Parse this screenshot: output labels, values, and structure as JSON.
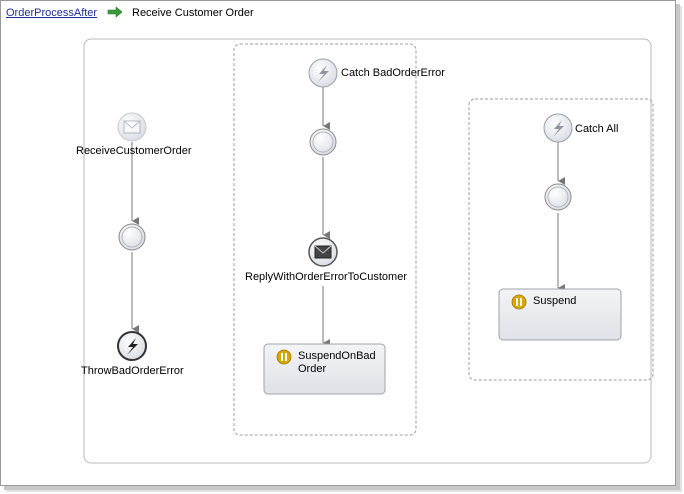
{
  "breadcrumb": {
    "parent_link": "OrderProcessAfter",
    "current": "Receive Customer Order"
  },
  "main_flow": {
    "receive_label": "ReceiveCustomerOrder",
    "throw_label": "ThrowBadOrderError"
  },
  "catch_bad_order": {
    "label": "Catch BadOrderError",
    "reply_label": "ReplyWithOrderErrorToCustomer",
    "suspend_label_line1": "SuspendOnBad",
    "suspend_label_line2": "Order"
  },
  "catch_all": {
    "label": "Catch All",
    "suspend_label": "Suspend"
  },
  "colors": {
    "link": "#1f2f9c",
    "arrow_green": "#3a9a3a",
    "suspend_gold": "#d8a800",
    "node_border": "#8a8a8a"
  }
}
